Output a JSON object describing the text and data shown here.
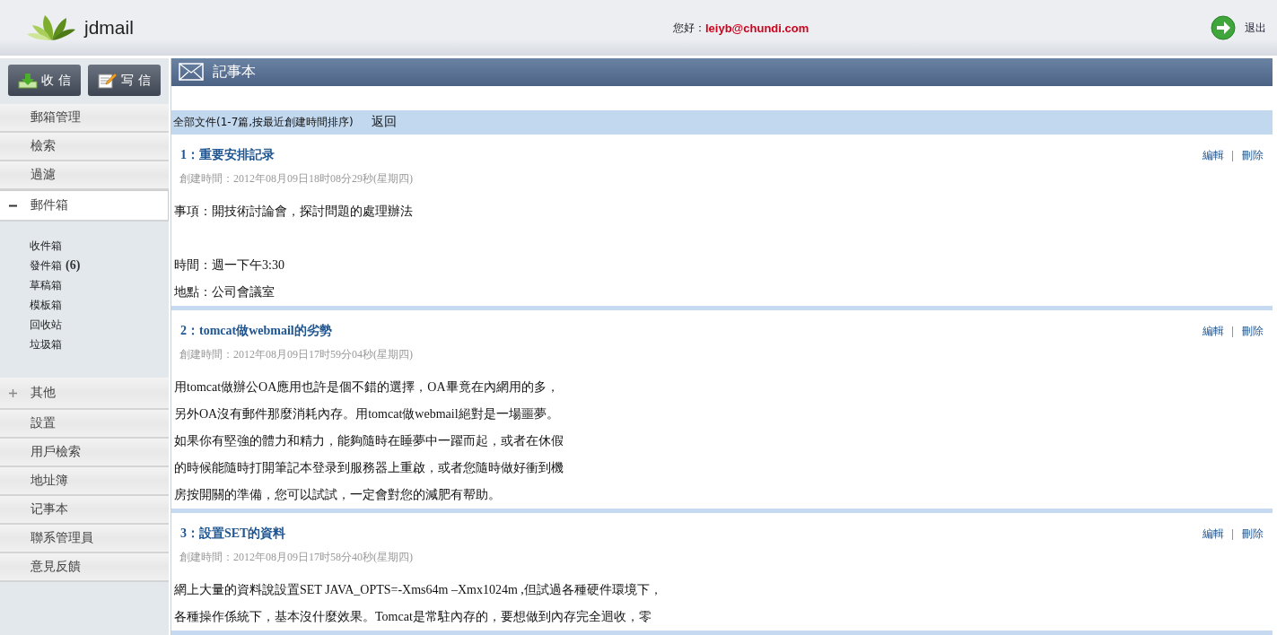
{
  "header": {
    "logo_text": "jdmail",
    "greeting": "您好：",
    "user_email": "leiyb@chundi.com",
    "logout": "退出"
  },
  "sidebar": {
    "buttons": [
      {
        "label": "收 信",
        "kind": "receive"
      },
      {
        "label": "写 信",
        "kind": "compose"
      }
    ],
    "menu": [
      {
        "label": "郵箱管理",
        "kind": "link"
      },
      {
        "label": "檢索",
        "kind": "link"
      },
      {
        "label": "過濾",
        "kind": "link"
      },
      {
        "label": "郵件箱",
        "kind": "folder",
        "expanded": true,
        "children": [
          {
            "label": "收件箱"
          },
          {
            "label": "發件箱",
            "count": "(6)"
          },
          {
            "label": "草稿箱"
          },
          {
            "label": "模板箱"
          },
          {
            "label": "回收站"
          },
          {
            "label": "垃圾箱"
          }
        ]
      },
      {
        "label": "其他",
        "kind": "folder",
        "expanded": false
      },
      {
        "label": "設置",
        "kind": "link"
      },
      {
        "label": "用戶檢索",
        "kind": "link"
      },
      {
        "label": "地址簿",
        "kind": "link"
      },
      {
        "label": "记事本",
        "kind": "link"
      },
      {
        "label": "聯系管理員",
        "kind": "link"
      },
      {
        "label": "意見反饋",
        "kind": "link"
      }
    ]
  },
  "main": {
    "title": "記事本",
    "summary": "全部文件(1-7篇,按最近創建時間排序)",
    "back": "返回",
    "notes": [
      {
        "title": "1：重要安排記录",
        "created": "創建時間：2012年08月09日18时08分29秒(星期四)",
        "actions": [
          "編輯",
          "刪除"
        ],
        "separator": "|",
        "paragraphs": [
          [
            "事項：開技術討論會，探討問題的處理辦法"
          ],
          [
            "時間：週一下午3:30",
            "地點：公司會議室"
          ]
        ]
      },
      {
        "title": "2：tomcat做webmail的劣勢",
        "created": "創建時間：2012年08月09日17时59分04秒(星期四)",
        "actions": [
          "編輯",
          "刪除"
        ],
        "separator": "|",
        "paragraphs": [
          [
            "用tomcat做辦公OA應用也許是個不錯的選擇，OA畢竟在內網用的多，",
            "另外OA沒有郵件那麼消耗內存。用tomcat做webmail絕對是一場噩夢。",
            "如果你有堅強的體力和精力，能夠隨時在睡夢中一躍而起，或者在休假",
            "的時候能隨時打開筆記本登录到服務器上重啟，或者您隨時做好衝到機",
            "房按開關的準備，您可以試試，一定會對您的減肥有帮助。"
          ]
        ]
      },
      {
        "title": "3：設置SET的資料",
        "created": "創建時間：2012年08月09日17时58分40秒(星期四)",
        "actions": [
          "編輯",
          "刪除"
        ],
        "separator": "|",
        "paragraphs": [
          [
            "網上大量的資料說設置SET JAVA_OPTS=-Xms64m –Xmx1024m ,但試過各種硬件環境下，",
            "各種操作係統下，基本沒什麼效果。Tomcat是常駐內存的，要想做到內存完全迴收，零"
          ]
        ]
      }
    ]
  }
}
